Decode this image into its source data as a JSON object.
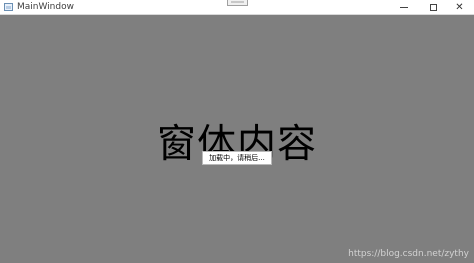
{
  "window": {
    "title": "MainWindow",
    "controls": {
      "close_glyph": "✕"
    }
  },
  "content": {
    "main_text": "窗体内容",
    "loading_text": "加载中，请稍后...",
    "watermark": "https://blog.csdn.net/zythy"
  },
  "colors": {
    "content_background": "#7f7f7f",
    "titlebar_background": "#ffffff"
  },
  "icons": [
    "app-icon",
    "minimize-icon",
    "maximize-icon",
    "close-icon"
  ]
}
